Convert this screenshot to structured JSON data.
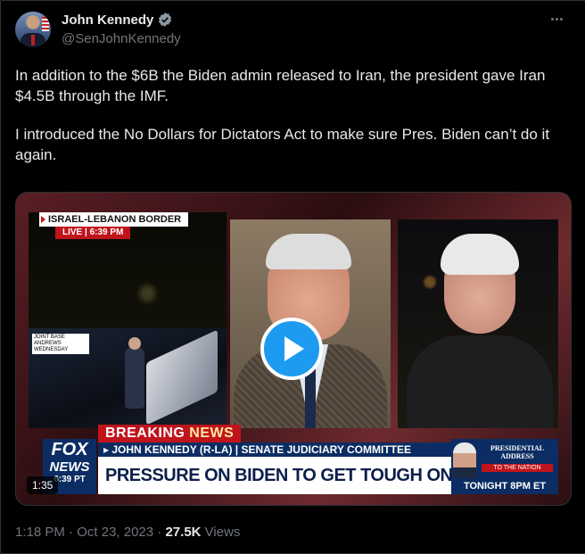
{
  "author": {
    "display_name": "John Kennedy",
    "handle": "@SenJohnKennedy",
    "verified_icon": "verified-badge-icon",
    "verified_color": "#8b98a5"
  },
  "tweet": {
    "paragraphs": [
      "In addition to the $6B the Biden admin released to Iran, the president gave Iran $4.5B through the IMF.",
      "I introduced the No Dollars for Dictators Act to make sure Pres. Biden can’t do it again."
    ]
  },
  "video": {
    "duration": "1:35",
    "play_color": "#1d9bf0",
    "overlays": {
      "border_label": "ISRAEL-LEBANON BORDER",
      "live_label": "LIVE | 6:39 PM",
      "andrews_label": "JOINT BASE ANDREWS WEDNESDAY",
      "breaking_prefix": "BREAKING",
      "breaking_suffix": "NEWS",
      "lower_third_sub": "▸ JOHN KENNEDY (R-LA) | SENATE JUDICIARY COMMITTEE",
      "lower_third_main": "PRESSURE ON BIDEN TO GET TOUGH ON IRAN",
      "fox_line1": "FOX",
      "fox_line2": "NEWS",
      "fox_time": "6:39 PT",
      "promo_title": "PRESIDENTIAL ADDRESS",
      "promo_sub": "TO THE NATION",
      "promo_time": "TONIGHT 8PM ET"
    }
  },
  "footer": {
    "time": "1:18 PM",
    "date": "Oct 23, 2023",
    "views_count": "27.5K",
    "views_label": "Views",
    "separator": "·"
  },
  "menu_icon": "more-options-icon"
}
